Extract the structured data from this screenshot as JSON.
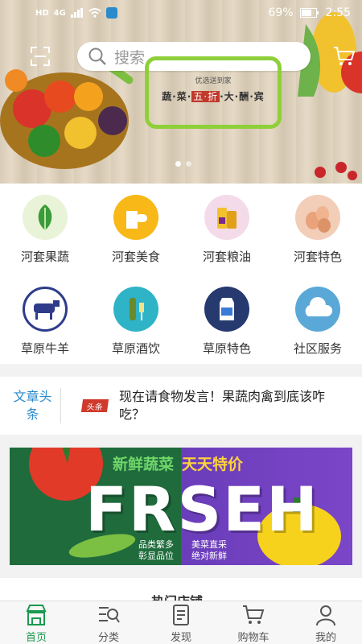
{
  "status_bar": {
    "network_left": "HD",
    "signal_label": "4G",
    "battery": "69%",
    "time": "2:55"
  },
  "search": {
    "placeholder": "搜索"
  },
  "hero": {
    "line1": "优选送到家",
    "line2_a": "蔬·菜·",
    "line2_b": "五·折",
    "line2_c": "·大·酬·宾"
  },
  "categories": [
    {
      "label": "河套果蔬",
      "icon": "vegetables-icon"
    },
    {
      "label": "河套美食",
      "icon": "food-icon"
    },
    {
      "label": "河套粮油",
      "icon": "oil-icon"
    },
    {
      "label": "河套特色",
      "icon": "eggs-icon"
    },
    {
      "label": "草原牛羊",
      "icon": "cattle-icon"
    },
    {
      "label": "草原酒饮",
      "icon": "drinks-icon"
    },
    {
      "label": "草原特色",
      "icon": "milk-icon"
    },
    {
      "label": "社区服务",
      "icon": "cloud-icon"
    }
  ],
  "news": {
    "tag": "文章头条",
    "badge": "头条",
    "headline": "现在请食物发言！果蔬肉禽到底该咋吃？"
  },
  "promo": {
    "headline_a": "新鲜蔬菜",
    "headline_b": "天天特价",
    "big": "FRSEH",
    "sub_a": "品类繁多\n彰显品位",
    "sub_b": "美菜直采\n绝对新鲜"
  },
  "section": {
    "title": "热门店铺"
  },
  "nav": [
    {
      "label": "首页",
      "active": true
    },
    {
      "label": "分类",
      "active": false
    },
    {
      "label": "发现",
      "active": false
    },
    {
      "label": "购物车",
      "active": false
    },
    {
      "label": "我的",
      "active": false
    }
  ]
}
